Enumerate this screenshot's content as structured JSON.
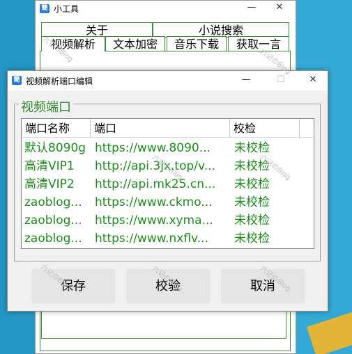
{
  "main_window": {
    "title": "小工具",
    "icon_glyph": "簡",
    "top_tabs": [
      "关于",
      "小说搜索"
    ],
    "tabs": [
      "视频解析",
      "文本加密",
      "音乐下载",
      "获取一言"
    ],
    "active_tab": "视频解析"
  },
  "dialog": {
    "title": "视频解析端口编辑",
    "icon_glyph": "簡",
    "group_label": "视频端口",
    "columns": [
      "端口名称",
      "端口",
      "校检"
    ],
    "rows": [
      {
        "name": "默认8090g",
        "url": "https://www.8090...",
        "status": "未校检"
      },
      {
        "name": "高清VIP1",
        "url": "http://api.3jx.top/v...",
        "status": "未校检"
      },
      {
        "name": "高清VIP2",
        "url": "http://api.mk25.cn...",
        "status": "未校检"
      },
      {
        "name": "zaoblog...",
        "url": "https://www.ckmo...",
        "status": "未校检"
      },
      {
        "name": "zaoblog...",
        "url": "https://www.xyma...",
        "status": "未校检"
      },
      {
        "name": "zaoblog...",
        "url": "https://www.nxflv...",
        "status": "未校检"
      }
    ],
    "buttons": {
      "save": "保存",
      "verify": "校验",
      "cancel": "取消"
    }
  },
  "watermark": "六记のBlog",
  "icons": {
    "minimize": "—",
    "maximize": "☐",
    "close": "✕"
  },
  "colors": {
    "accent_green": "#208a20",
    "tab_border": "#3f8a3f",
    "button": "#e5e5e5"
  }
}
